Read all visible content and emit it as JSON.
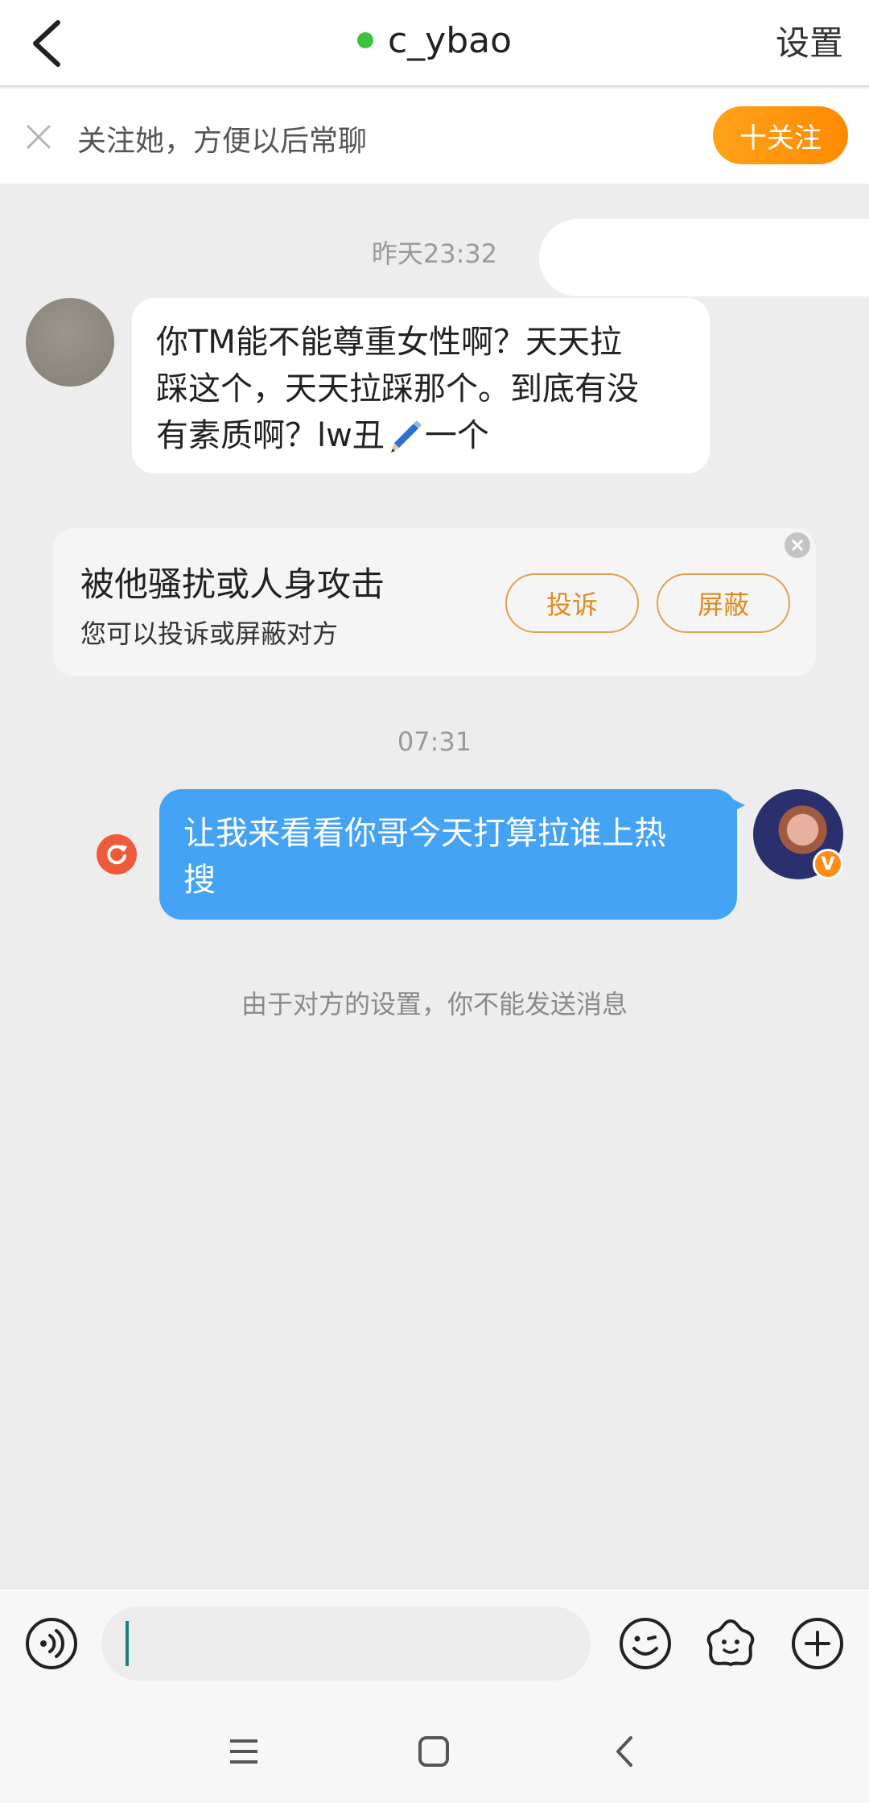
{
  "header": {
    "title": "c_ybao",
    "settings_label": "设置",
    "online_color": "#3ec13e"
  },
  "follow_bar": {
    "text": "关注她，方便以后常聊",
    "button_label": "十关注"
  },
  "messages": [
    {
      "timestamp": "昨天23:32"
    },
    {
      "sender": "them",
      "text_line1": "你TM能不能尊重女性啊？天天拉",
      "text_line2": "踩这个，天天拉踩那个。到底有没",
      "text_line3_prefix": "有素质啊？lw丑",
      "text_line3_suffix": "一个"
    },
    {
      "timestamp": "07:31"
    },
    {
      "sender": "me",
      "text_line1": "让我来看看你哥今天打算拉谁上热",
      "text_line2": "搜",
      "badge": "V"
    }
  ],
  "harass_card": {
    "title": "被他骚扰或人身攻击",
    "subtitle": "您可以投诉或屏蔽对方",
    "complain_label": "投诉",
    "block_label": "屏蔽"
  },
  "system_note": "由于对方的设置，你不能发送消息",
  "icons": [
    "back-icon",
    "close-icon",
    "voice-icon",
    "emoji-icon",
    "sticker-icon",
    "add-icon",
    "menu-icon",
    "home-icon",
    "nav-back-icon",
    "resend-icon",
    "pen-emoji-icon"
  ],
  "colors": {
    "accent_orange": "#ff8a00",
    "my_bubble": "#45a3f5",
    "chat_bg": "#ededed"
  }
}
